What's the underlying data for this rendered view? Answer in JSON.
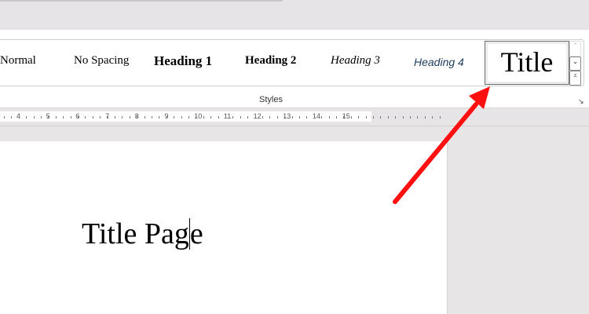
{
  "ribbon": {
    "styles": [
      {
        "label": "Normal"
      },
      {
        "label": "No Spacing"
      },
      {
        "label": "Heading 1"
      },
      {
        "label": "Heading 2"
      },
      {
        "label": "Heading 3"
      },
      {
        "label": "Heading 4"
      }
    ],
    "selected_style": "Title",
    "group_label": "Styles",
    "scroll_up": "⌃",
    "scroll_down": "⌄",
    "more": "⩡",
    "launcher": "↘"
  },
  "ruler": {
    "numbers": [
      "4",
      "5",
      "6",
      "7",
      "8",
      "9",
      "10",
      "11",
      "12",
      "13",
      "14",
      "15"
    ]
  },
  "document": {
    "text_before_cursor": "Title Pag",
    "text_after_cursor": "e"
  },
  "colors": {
    "arrow": "#ff1010",
    "heading4": "#1f3f60"
  }
}
